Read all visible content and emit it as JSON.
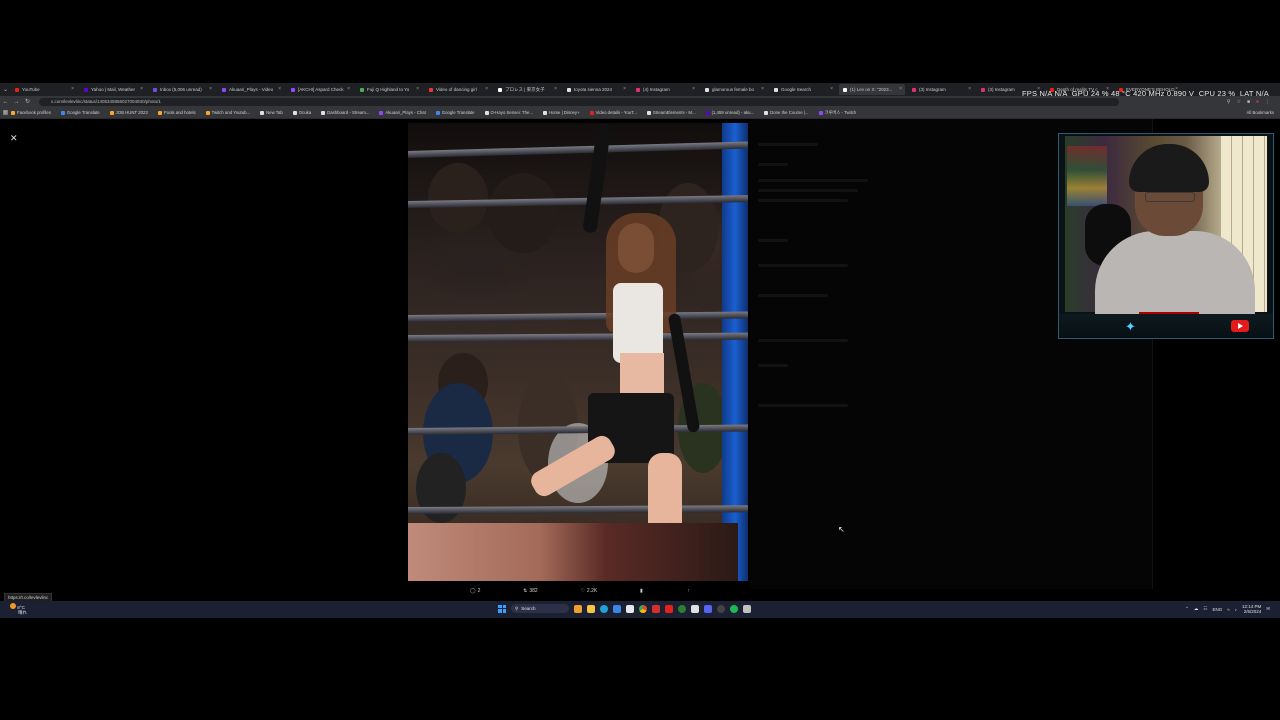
{
  "browser": {
    "tabs": [
      {
        "title": "YouTube",
        "color": "#e62117"
      },
      {
        "title": "Yahoo | Mail, Weather",
        "color": "#6001d2"
      },
      {
        "title": "Inbox (5,006 unread)",
        "color": "#7b4ae2"
      },
      {
        "title": "Akuaari_Plays - Video",
        "color": "#9146ff"
      },
      {
        "title": "[AKCHI] Aspard Check",
        "color": "#9146ff"
      },
      {
        "title": "Fuji Q Highland to Yo",
        "color": "#4caf50"
      },
      {
        "title": "Video of dancing girl",
        "color": "#e53935"
      },
      {
        "title": "プロレス | 東京女子",
        "color": "#ffffff"
      },
      {
        "title": "toyota sienna 2024",
        "color": "#e0e0e0"
      },
      {
        "title": "(4) Instagram",
        "color": "#e1306c"
      },
      {
        "title": "glamorous female bo",
        "color": "#e0e0e0"
      },
      {
        "title": "Google Search",
        "color": "#e0e0e0"
      },
      {
        "title": "(1) Lev on X: \"2023...",
        "color": "#ffffff",
        "active": true
      },
      {
        "title": "(3) Instagram",
        "color": "#e1306c"
      },
      {
        "title": "(3) Instagram",
        "color": "#e1306c"
      },
      {
        "title": "Depth of reality TV c",
        "color": "#e62117"
      },
      {
        "title": "EVERYONE'S BEHOLD",
        "color": "#e62117"
      }
    ],
    "url": "x.com/levlevlinc/status/1405345856027004930/photo/1",
    "bookmarks": [
      {
        "label": "Facebook profiles",
        "color": "#f9a825"
      },
      {
        "label": "Google Translate",
        "color": "#4285f4"
      },
      {
        "label": "JOB HUNT 2023",
        "color": "#f9a825"
      },
      {
        "label": "Pools and hotels",
        "color": "#f9a825"
      },
      {
        "label": "Twitch and Youtub...",
        "color": "#f9a825"
      },
      {
        "label": "New Tab",
        "color": "#e0e0e0"
      },
      {
        "label": "Ocuka",
        "color": "#e0e0e0"
      },
      {
        "label": "Dashboard - Stream...",
        "color": "#e0e0e0"
      },
      {
        "label": "Akuaari_Plays - Chat",
        "color": "#9146ff"
      },
      {
        "label": "Google Translate",
        "color": "#4285f4"
      },
      {
        "label": "O-Hayo Sensei: The...",
        "color": "#e0e0e0"
      },
      {
        "label": "Home | Disney+",
        "color": "#e0e0e0"
      },
      {
        "label": "Video details - YouT...",
        "color": "#e62117"
      },
      {
        "label": "StreamElements - M...",
        "color": "#e0e0e0"
      },
      {
        "label": "(1,459 unread) - aku...",
        "color": "#6001d2"
      },
      {
        "label": "Done the Course |...",
        "color": "#e0e0e0"
      },
      {
        "label": "크루버스 - Twitch",
        "color": "#9146ff"
      }
    ],
    "all_bookmarks": "All Bookmarks"
  },
  "overlay_stats": {
    "fps": "FPS N/A N/A",
    "gpu": "GPU 24 % 48 °C 420 MHz 0.890 V",
    "cpu": "CPU 23 %",
    "lat": "LAT N/A"
  },
  "tweet": {
    "replies": "2",
    "reposts": "382",
    "likes": "2.2K",
    "views": "",
    "link_preview": "https://t.co/levlevlinc"
  },
  "taskbar": {
    "weather_temp": "8°C",
    "weather_desc": "晴れ",
    "search_label": "Search",
    "language": "ENG",
    "time": "12:14 PM",
    "date": "2/5/2024"
  },
  "colors": {
    "accent_blue": "#1d9bf0",
    "corner_post": "#1b5fd0",
    "webcam_border": "#2a5d70"
  }
}
